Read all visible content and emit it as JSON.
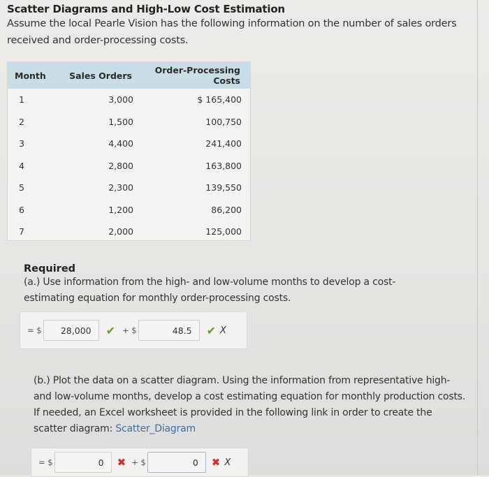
{
  "title": "Scatter Diagrams and High-Low Cost Estimation",
  "intro": "Assume the local Pearle Vision has the following information on the number of sales orders received and order-processing costs.",
  "table": {
    "headers": [
      "Month",
      "Sales Orders",
      "Order-Processing Costs"
    ],
    "rows": [
      {
        "month": "1",
        "sales": "3,000",
        "cost": "$ 165,400"
      },
      {
        "month": "2",
        "sales": "1,500",
        "cost": "100,750"
      },
      {
        "month": "3",
        "sales": "4,400",
        "cost": "241,400"
      },
      {
        "month": "4",
        "sales": "2,800",
        "cost": "163,800"
      },
      {
        "month": "5",
        "sales": "2,300",
        "cost": "139,550"
      },
      {
        "month": "6",
        "sales": "1,200",
        "cost": "86,200"
      },
      {
        "month": "7",
        "sales": "2,000",
        "cost": "125,000"
      }
    ]
  },
  "required": {
    "heading": "Required",
    "part_a": {
      "text": "(a.) Use information from the high- and low-volume months to develop a cost-estimating equation for monthly order-processing costs.",
      "prefix1": "= $",
      "value1": "28,000",
      "status1": "correct",
      "prefix2": "+ $",
      "value2": "48.5",
      "status2": "correct",
      "variable": "X"
    },
    "part_b": {
      "text": "(b.) Plot the data on a scatter diagram. Using the information from representative high- and low-volume months, develop a cost estimating equation for monthly production costs. If needed, an Excel worksheet is provided in the following link in order to create the scatter diagram: ",
      "link_text": "Scatter_Diagram",
      "prefix1": "= $",
      "value1": "0",
      "status1": "incorrect",
      "prefix2": "+ $",
      "value2": "0",
      "status2": "incorrect",
      "variable": "X"
    }
  },
  "icons": {
    "correct": "✔",
    "incorrect": "✖"
  },
  "colors": {
    "table_header": "#c9dde6",
    "correct": "#5a9e2d",
    "incorrect": "#d62a2a",
    "link": "#3a6ea5"
  }
}
